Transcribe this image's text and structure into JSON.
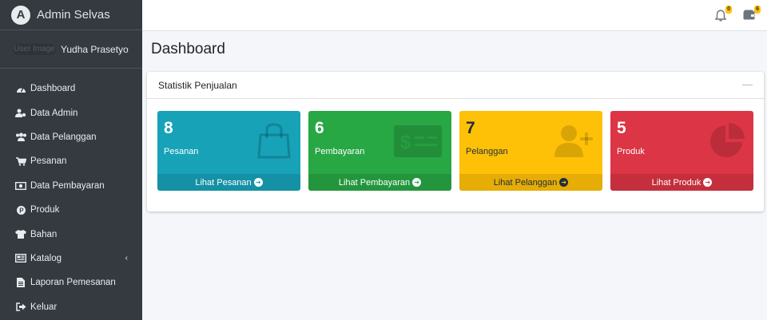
{
  "brand": {
    "title": "Admin Selvas",
    "logo_letter": "A"
  },
  "user": {
    "image_alt": "User Image",
    "name": "Yudha Prasetyo"
  },
  "sidebar": {
    "items": [
      {
        "label": "Dashboard",
        "icon": "tachometer-icon"
      },
      {
        "label": "Data Admin",
        "icon": "user-cog-icon"
      },
      {
        "label": "Data Pelanggan",
        "icon": "users-icon"
      },
      {
        "label": "Pesanan",
        "icon": "cart-icon"
      },
      {
        "label": "Data Pembayaran",
        "icon": "money-icon"
      },
      {
        "label": "Produk",
        "icon": "product-icon"
      },
      {
        "label": "Bahan",
        "icon": "shirt-icon"
      },
      {
        "label": "Katalog",
        "icon": "catalog-icon",
        "arrow": "‹"
      },
      {
        "label": "Laporan Pemesanan",
        "icon": "report-icon"
      },
      {
        "label": "Keluar",
        "icon": "logout-icon"
      }
    ]
  },
  "topbar": {
    "notifications_count": "0",
    "wallet_count": "6"
  },
  "page": {
    "title": "Dashboard"
  },
  "card": {
    "title": "Statistik Penjualan",
    "collapse_symbol": "—"
  },
  "boxes": [
    {
      "value": "8",
      "label": "Pesanan",
      "link": "Lihat Pesanan",
      "color": "#17a2b8",
      "icon": "shopping-bag-icon"
    },
    {
      "value": "6",
      "label": "Pembayaran",
      "link": "Lihat Pembayaran",
      "color": "#28a745",
      "icon": "money-bill-icon"
    },
    {
      "value": "7",
      "label": "Pelanggan",
      "link": "Lihat Pelanggan",
      "color": "#ffc107",
      "icon": "user-plus-icon"
    },
    {
      "value": "5",
      "label": "Produk",
      "link": "Lihat Produk",
      "color": "#dc3545",
      "icon": "pie-chart-icon"
    }
  ]
}
